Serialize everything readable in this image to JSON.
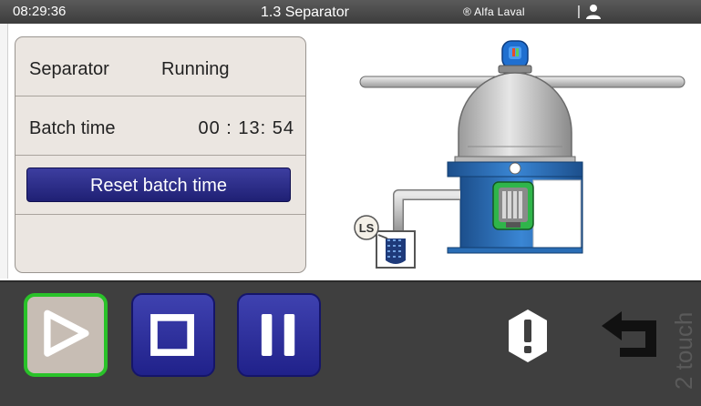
{
  "topbar": {
    "time": "08:29:36",
    "title": "1.3 Separator",
    "brand": "® Alfa Laval",
    "separator": "|",
    "user_icon": "user-icon"
  },
  "status_panel": {
    "separator_label": "Separator",
    "separator_value": "Running",
    "batch_time_label": "Batch time",
    "batch_time_value": "00 : 13: 54",
    "reset_button_label": "Reset batch time"
  },
  "graphic": {
    "level_switch_label": "LS",
    "beacon_icon": "beacon-icon",
    "motor_icon": "motor-icon"
  },
  "toolbar": {
    "play_icon": "play-icon",
    "stop_icon": "stop-icon",
    "pause_icon": "pause-icon",
    "alarm_icon": "alarm-icon",
    "back_icon": "back-icon",
    "brand_vertical": "2 touch"
  },
  "colors": {
    "topbar": "#4a4a4a",
    "button_blue": "#2a2c96",
    "active_green": "#29c229",
    "panel_bg": "#ebe6e1",
    "tank_blue": "#2a6db5"
  }
}
